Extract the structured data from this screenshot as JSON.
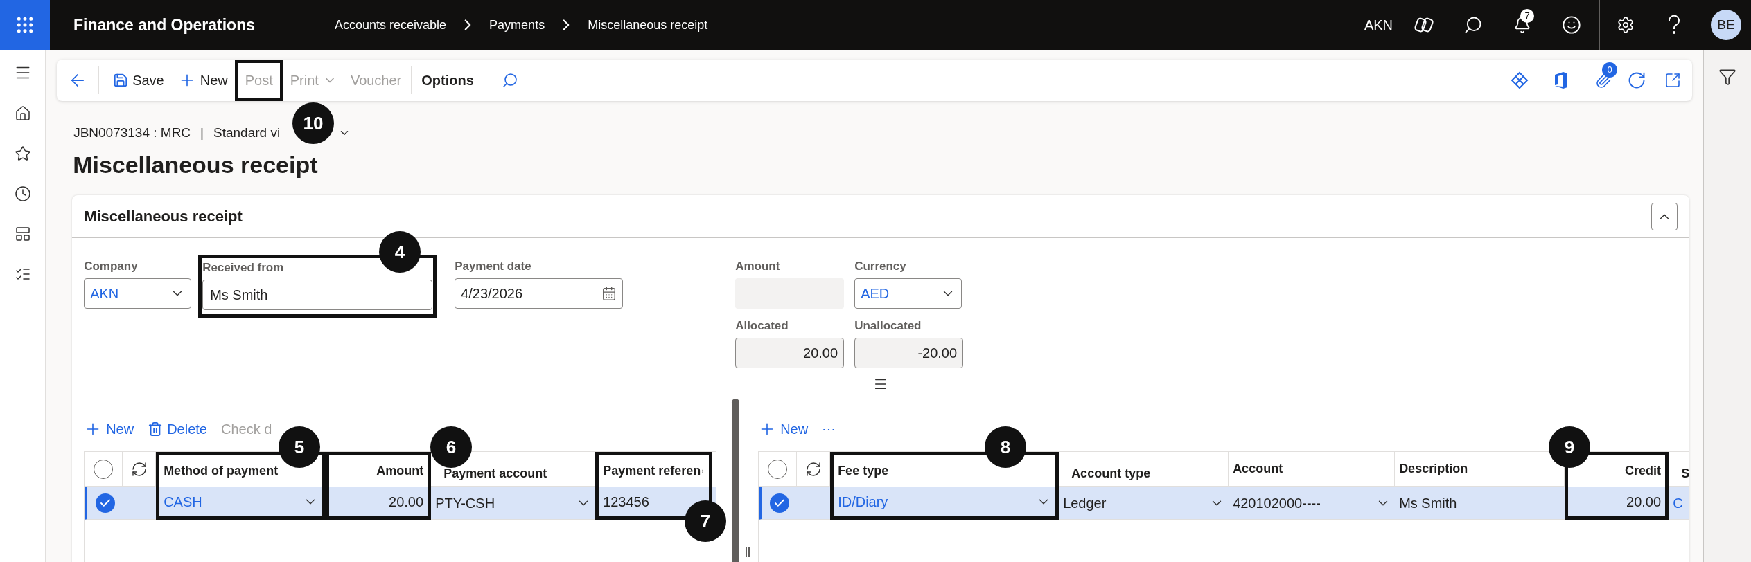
{
  "app_bar": {
    "title": "Finance and Operations",
    "breadcrumbs": [
      "Accounts receivable",
      "Payments",
      "Miscellaneous receipt"
    ],
    "company": "AKN",
    "notification_count": "7",
    "avatar": "BE"
  },
  "action_pane": {
    "buttons": [
      {
        "label": "Save",
        "kind": "save",
        "disabled": false,
        "framed": false
      },
      {
        "label": "New",
        "kind": "add",
        "disabled": false,
        "framed": false
      },
      {
        "label": "Post",
        "kind": "plain",
        "disabled": true,
        "framed": true
      },
      {
        "label": "Print",
        "kind": "menu",
        "disabled": true,
        "framed": false
      },
      {
        "label": "Voucher",
        "kind": "plain",
        "disabled": true,
        "framed": false
      },
      {
        "label": "Options",
        "kind": "tab",
        "disabled": false,
        "framed": false
      }
    ],
    "attachments_count": "0"
  },
  "caption": "JBN0073134 : MRC",
  "separator": "|",
  "view": "Standard vi",
  "page_title": "Miscellaneous receipt",
  "card": {
    "title": "Miscellaneous receipt",
    "expanded": true,
    "groups": [
      {
        "fields": [
          {
            "label": "Company",
            "value": "AKN",
            "kind": "combo",
            "framed": false
          }
        ]
      },
      {
        "fields": [
          {
            "label": "Received from",
            "value": "Ms Smith",
            "kind": "text",
            "framed": true
          }
        ]
      },
      {
        "fields": [
          {
            "label": "Payment date",
            "value": "4/23/2026",
            "kind": "date",
            "framed": false
          }
        ]
      },
      {
        "fields": [
          {
            "label": "Amount",
            "kind": "readonly",
            "framed": false
          },
          {
            "label": "Allocated",
            "value": "20.00",
            "kind": "readonly",
            "framed": false
          }
        ]
      },
      {
        "fields": [
          {
            "label": "Currency",
            "value": "AED",
            "kind": "combo",
            "framed": false
          },
          {
            "label": "Unallocated",
            "value": "-20.00",
            "kind": "readonly",
            "framed": false
          }
        ]
      }
    ]
  },
  "payments_grid": {
    "toolbar": [
      {
        "label": "New",
        "kind": "add",
        "disabled": false
      },
      {
        "label": "Delete",
        "kind": "delete",
        "disabled": false
      },
      {
        "label": "Check d",
        "kind": "plain",
        "disabled": true
      }
    ],
    "all_selected": false,
    "columns": [
      {
        "label": "Method of payment",
        "kind": "combo",
        "framed": true
      },
      {
        "label": "Amount",
        "kind": "number",
        "framed": true
      },
      {
        "label": "Payment account",
        "kind": "combo",
        "framed": false
      },
      {
        "label": "Payment referen",
        "kind": "text",
        "framed": true
      }
    ],
    "rows": [
      {
        "selected": true,
        "cells": [
          "CASH",
          "20.00",
          "PTY-CSH",
          "123456"
        ]
      }
    ]
  },
  "fees_grid": {
    "toolbar": [
      {
        "label": "New",
        "kind": "add",
        "disabled": false
      },
      {
        "label": "⋯",
        "kind": "plain",
        "disabled": false
      }
    ],
    "all_selected": false,
    "columns": [
      {
        "label": "Fee type",
        "kind": "combo",
        "framed": true
      },
      {
        "label": "Account type",
        "kind": "combo",
        "framed": false
      },
      {
        "label": "Account",
        "kind": "combo",
        "framed": false
      },
      {
        "label": "Description",
        "kind": "text",
        "framed": false
      },
      {
        "label": "Credit",
        "kind": "number",
        "framed": true
      },
      {
        "label": "S",
        "kind": "cut",
        "framed": false
      }
    ],
    "rows": [
      {
        "selected": true,
        "cells": [
          "ID/Diary",
          "Ledger",
          "420102000----",
          "Ms Smith",
          "20.00",
          "C"
        ]
      }
    ]
  },
  "callouts": [
    {
      "number": "10"
    },
    {
      "number": "4"
    },
    {
      "number": "5"
    },
    {
      "number": "6"
    },
    {
      "number": "7"
    },
    {
      "number": "8"
    },
    {
      "number": "9"
    }
  ]
}
